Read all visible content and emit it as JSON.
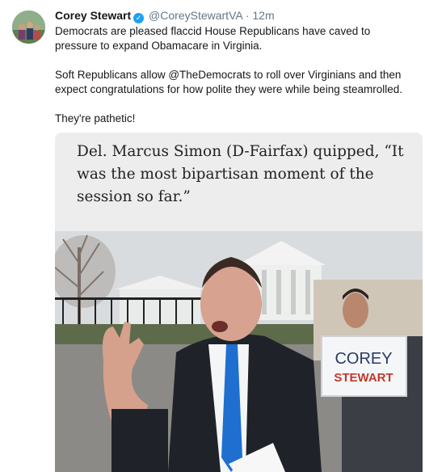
{
  "tweet": {
    "display_name": "Corey Stewart",
    "handle": "@CoreyStewartVA",
    "separator": "·",
    "time": "12m",
    "paragraphs": [
      "Democrats are pleased flaccid House Republicans have caved to pressure to expand Obamacare in Virginia.",
      "Soft Republicans allow @TheDemocrats to roll over Virginians and then expect congratulations for how polite they were while being steamrolled.",
      "They're pathetic!"
    ]
  },
  "card": {
    "quote": "Del. Marcus Simon (D-Fairfax) quipped, “It was the most bipartisan moment of the session so far.”",
    "sign_line1": "COREY",
    "sign_line2": "STEWART"
  },
  "colors": {
    "verified": "#1da1f2",
    "meta": "#657786",
    "text": "#14171a"
  }
}
